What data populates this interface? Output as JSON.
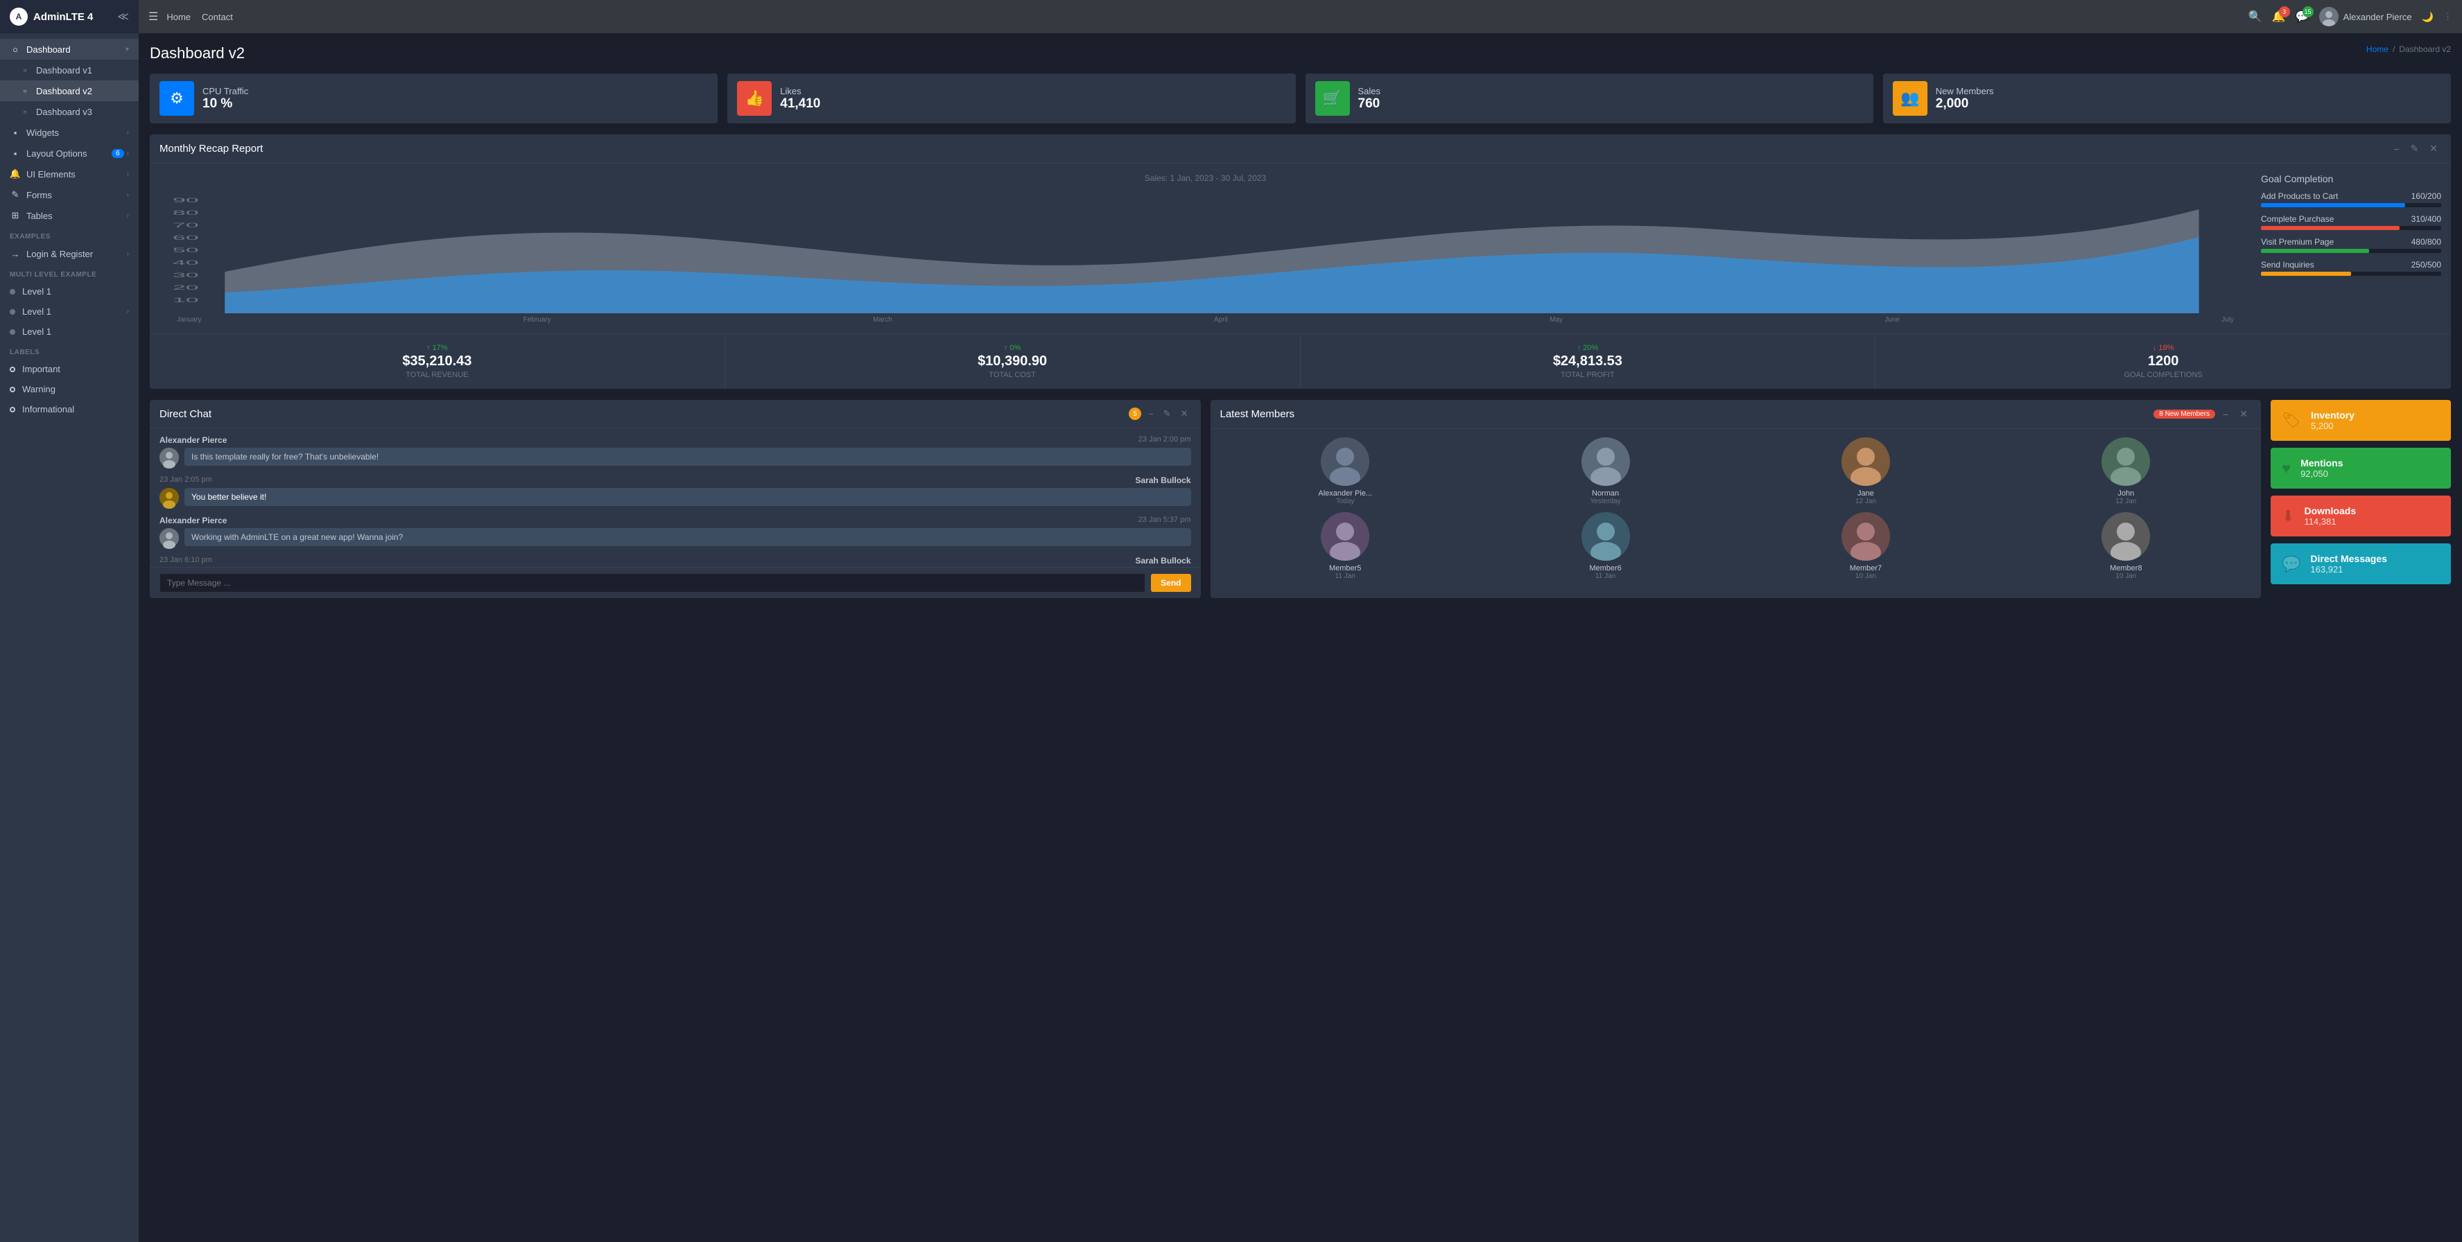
{
  "app": {
    "name": "AdminLTE 4"
  },
  "topbar": {
    "nav_items": [
      "Home",
      "Contact"
    ],
    "notifications_count": "3",
    "messages_count": "15",
    "username": "Alexander Pierce",
    "theme_icon": "🌙"
  },
  "sidebar": {
    "dashboard_label": "Dashboard",
    "items": [
      {
        "id": "dashboard-v1",
        "label": "Dashboard v1",
        "icon": "○",
        "active": false
      },
      {
        "id": "dashboard-v2",
        "label": "Dashboard v2",
        "icon": "○",
        "active": true
      },
      {
        "id": "dashboard-v3",
        "label": "Dashboard v3",
        "icon": "○",
        "active": false
      },
      {
        "id": "widgets",
        "label": "Widgets",
        "icon": "▪",
        "has_arrow": true
      },
      {
        "id": "layout-options",
        "label": "Layout Options",
        "icon": "▪",
        "badge": "6",
        "has_arrow": true
      },
      {
        "id": "ui-elements",
        "label": "UI Elements",
        "icon": "▪",
        "has_arrow": true
      },
      {
        "id": "forms",
        "label": "Forms",
        "icon": "▪",
        "has_arrow": true
      },
      {
        "id": "tables",
        "label": "Tables",
        "icon": "▪",
        "has_arrow": true
      }
    ],
    "examples_section": "EXAMPLES",
    "examples_items": [
      {
        "id": "login-register",
        "label": "Login & Register",
        "has_arrow": true
      }
    ],
    "multi_level_section": "MULTI LEVEL EXAMPLE",
    "multi_level_items": [
      {
        "id": "level1-a",
        "label": "Level 1"
      },
      {
        "id": "level1-b",
        "label": "Level 1",
        "has_arrow": true
      },
      {
        "id": "level1-c",
        "label": "Level 1"
      }
    ],
    "labels_section": "LABELS",
    "labels_items": [
      {
        "id": "important",
        "label": "Important",
        "color": "red"
      },
      {
        "id": "warning",
        "label": "Warning",
        "color": "yellow"
      },
      {
        "id": "informational",
        "label": "Informational",
        "color": "teal"
      }
    ]
  },
  "page": {
    "title": "Dashboard v2",
    "breadcrumb_home": "Home",
    "breadcrumb_current": "Dashboard v2"
  },
  "info_boxes": [
    {
      "id": "cpu",
      "icon": "⚙",
      "color": "ib-blue",
      "label": "CPU Traffic",
      "value": "10 %"
    },
    {
      "id": "likes",
      "icon": "👍",
      "color": "ib-red",
      "label": "Likes",
      "value": "41,410"
    },
    {
      "id": "sales",
      "icon": "🛒",
      "color": "ib-green",
      "label": "Sales",
      "value": "760"
    },
    {
      "id": "members",
      "icon": "👥",
      "color": "ib-yellow",
      "label": "New Members",
      "value": "2,000"
    }
  ],
  "monthly_report": {
    "title": "Monthly Recap Report",
    "chart_subtitle": "Sales: 1 Jan, 2023 - 30 Jul, 2023",
    "x_labels": [
      "January",
      "February",
      "March",
      "April",
      "May",
      "June",
      "July"
    ],
    "goal_title": "Goal Completion",
    "goals": [
      {
        "label": "Add Products to Cart",
        "progress": 80,
        "text": "160/200",
        "color": "gb-blue"
      },
      {
        "label": "Complete Purchase",
        "progress": 77,
        "text": "310/400",
        "color": "gb-red"
      },
      {
        "label": "Visit Premium Page",
        "progress": 60,
        "text": "480/800",
        "color": "gb-green"
      },
      {
        "label": "Send Inquiries",
        "progress": 50,
        "text": "250/500",
        "color": "gb-yellow"
      }
    ]
  },
  "stats": [
    {
      "value": "$35,210.43",
      "label": "TOTAL REVENUE",
      "change": "↑ 17%",
      "direction": "up"
    },
    {
      "value": "$10,390.90",
      "label": "TOTAL COST",
      "change": "↑ 0%",
      "direction": "up"
    },
    {
      "value": "$24,813.53",
      "label": "TOTAL PROFIT",
      "change": "↑ 20%",
      "direction": "up"
    },
    {
      "value": "1200",
      "label": "GOAL COMPLETIONS",
      "change": "↓ 18%",
      "direction": "down"
    }
  ],
  "direct_chat": {
    "title": "Direct Chat",
    "badge": "5",
    "messages": [
      {
        "name": "Alexander Pierce",
        "time": "23 Jan 2:00 pm",
        "text": "Is this template really for free? That's unbelievable!",
        "side": "left"
      },
      {
        "name": "Sarah Bullock",
        "time": "23 Jan 2:05 pm",
        "text": "You better believe it!",
        "side": "right",
        "bubble_class": "yellow"
      },
      {
        "name": "Alexander Pierce",
        "time": "23 Jan 5:37 pm",
        "text": "Working with AdminLTE on a great new app! Wanna join?",
        "side": "left"
      },
      {
        "name": "Sarah Bullock",
        "time": "23 Jan 6:10 pm",
        "text": "",
        "side": "right"
      }
    ],
    "input_placeholder": "Type Message ...",
    "send_label": "Send"
  },
  "latest_members": {
    "title": "Latest Members",
    "badge": "8 New Members",
    "members": [
      {
        "name": "Alexander Pie...",
        "date": "Today"
      },
      {
        "name": "Norman",
        "date": "Yesterday"
      },
      {
        "name": "Jane",
        "date": "12 Jan"
      },
      {
        "name": "John",
        "date": "12 Jan"
      },
      {
        "name": "Member5",
        "date": "11 Jan"
      },
      {
        "name": "Member6",
        "date": "11 Jan"
      },
      {
        "name": "Member7",
        "date": "10 Jan"
      },
      {
        "name": "Member8",
        "date": "10 Jan"
      }
    ]
  },
  "widgets": [
    {
      "id": "inventory",
      "label": "Inventory",
      "value": "5,200",
      "color": "wb-yellow",
      "icon": "🏷"
    },
    {
      "id": "mentions",
      "label": "Mentions",
      "value": "92,050",
      "color": "wb-green",
      "icon": "♥"
    },
    {
      "id": "downloads",
      "label": "Downloads",
      "value": "114,381",
      "color": "wb-red",
      "icon": "⬇"
    },
    {
      "id": "direct-messages",
      "label": "Direct Messages",
      "value": "163,921",
      "color": "wb-cyan",
      "icon": "💬"
    }
  ]
}
